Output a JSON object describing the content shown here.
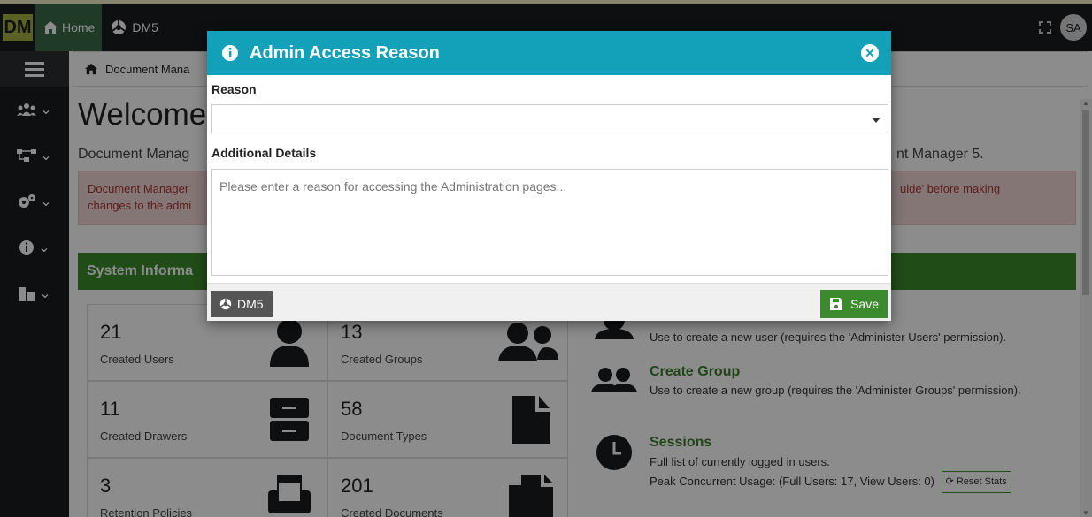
{
  "app": {
    "logo": "DM",
    "home_label": "Home",
    "dm5_label": "DM5",
    "avatar": "SA"
  },
  "breadcrumb": {
    "label": "Document Mana"
  },
  "page": {
    "welcome": "Welcome",
    "subtitle_left": "Document Manag",
    "subtitle_right": "nt Manager 5.",
    "alert_line1": "Document Manager",
    "alert_line2": "changes to the admi",
    "alert_right": "uide' before making",
    "panel_title": "System Informa"
  },
  "stats": [
    {
      "value": "21",
      "label": "Created Users",
      "icon": "user-icon"
    },
    {
      "value": "13",
      "label": "Created Groups",
      "icon": "group-icon"
    },
    {
      "value": "11",
      "label": "Created Drawers",
      "icon": "drawer-icon"
    },
    {
      "value": "58",
      "label": "Document Types",
      "icon": "document-icon"
    },
    {
      "value": "3",
      "label": "Retention Policies",
      "icon": "printer-icon"
    },
    {
      "value": "201",
      "label": "Created Documents",
      "icon": "documents-icon"
    }
  ],
  "actions": {
    "create_user_desc": "Use to create a new user (requires the 'Administer Users' permission).",
    "create_group_title": "Create Group",
    "create_group_desc": "Use to create a new group (requires the 'Administer Groups' permission).",
    "sessions_title": "Sessions",
    "sessions_desc": "Full list of currently logged in users.",
    "peak_usage": "Peak Concurrent Usage: (Full Users: 17, View Users: 0)",
    "reset_label": "Reset Stats"
  },
  "modal": {
    "title": "Admin Access Reason",
    "reason_label": "Reason",
    "reason_value": "",
    "details_label": "Additional Details",
    "details_placeholder": "Please enter a reason for accessing the Administration pages...",
    "dm5_button": "DM5",
    "save_button": "Save"
  },
  "colors": {
    "modal_header": "#13a0b9",
    "panel_green": "#3b8a2d",
    "navbar": "#1b1d1f"
  }
}
